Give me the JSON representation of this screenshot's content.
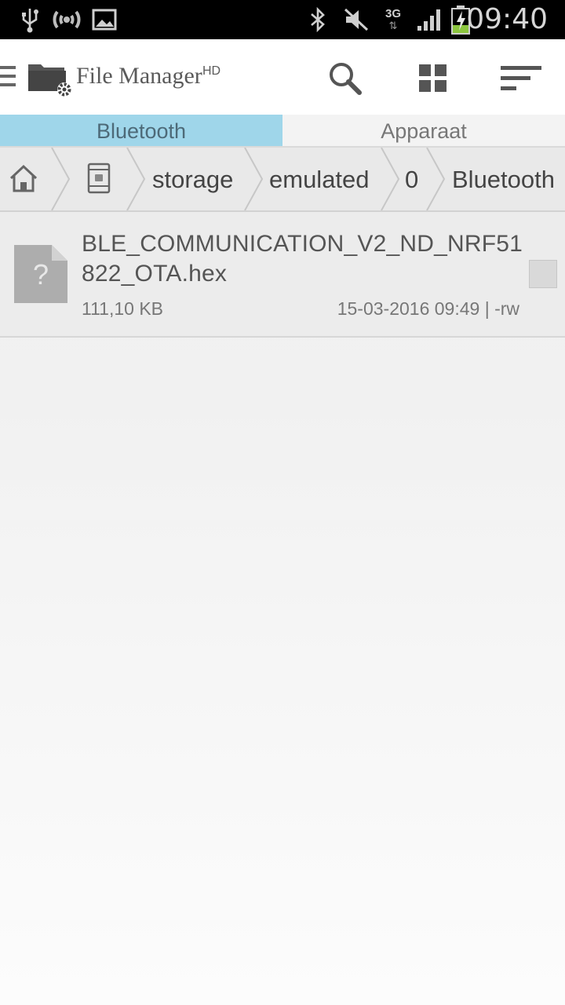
{
  "status_bar": {
    "time": "09:40",
    "network": "3G",
    "icons": [
      "usb-icon",
      "wifi-signal-icon",
      "image-notification-icon",
      "bluetooth-icon",
      "mute-icon",
      "network-3g-icon",
      "cell-signal-icon",
      "battery-charging-icon"
    ]
  },
  "action_bar": {
    "title": "File Manager",
    "title_sup": "HD",
    "buttons": [
      "search-icon",
      "grid-view-icon",
      "sort-icon"
    ]
  },
  "tabs": [
    {
      "label": "Bluetooth",
      "active": true
    },
    {
      "label": "Apparaat",
      "active": false
    }
  ],
  "breadcrumb": {
    "items": [
      "storage",
      "emulated",
      "0",
      "Bluetooth"
    ]
  },
  "files": [
    {
      "name": "BLE_COMMUNICATION_V2_ND_NRF51822_OTA.hex",
      "size": "111,10 KB",
      "meta": "15-03-2016 09:49 | -rw",
      "icon": "unknown-file-icon"
    }
  ],
  "colors": {
    "tab_active": "#9fd6ea",
    "status_bar": "#000000",
    "action_bar": "#ffffff"
  }
}
